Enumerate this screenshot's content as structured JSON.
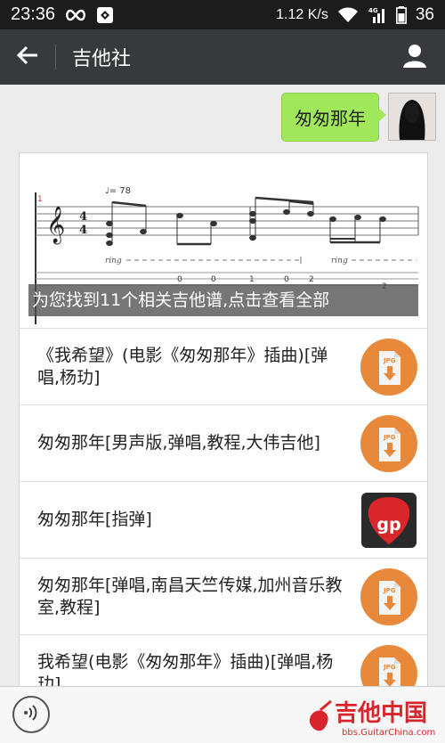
{
  "status": {
    "time": "23:36",
    "network": "4G",
    "battery_percent_text": "1.12 K/s",
    "battery_level": "36"
  },
  "header": {
    "title": "吉他社"
  },
  "message": {
    "text": "匆匆那年"
  },
  "result_card": {
    "overlay_text": "为您找到11个相关吉他谱,点击查看全部",
    "tab_preview": {
      "measure_number": "1",
      "tempo": "♩= 78",
      "time_sig_top": "4",
      "time_sig_bottom": "4",
      "ring_label": "ring",
      "tab_numbers": [
        "0",
        "0",
        "1",
        "0",
        "2",
        "2"
      ]
    },
    "items": [
      {
        "label": "《我希望》(电影《匆匆那年》插曲)[弹唱,杨玏]",
        "thumb_type": "jpg",
        "thumb_label": "JPG"
      },
      {
        "label": "匆匆那年[男声版,弹唱,教程,大伟吉他]",
        "thumb_type": "jpg",
        "thumb_label": "JPG"
      },
      {
        "label": "匆匆那年[指弹]",
        "thumb_type": "gp",
        "thumb_label": "gp"
      },
      {
        "label": "匆匆那年[弹唱,南昌天竺传媒,加州音乐教室,教程]",
        "thumb_type": "jpg",
        "thumb_label": "JPG"
      },
      {
        "label": "我希望(电影《匆匆那年》插曲)[弹唱,杨玏]",
        "thumb_type": "jpg",
        "thumb_label": "JPG"
      }
    ]
  },
  "watermark": {
    "title": "吉他中国",
    "url": "bbs.GuitarChina.com"
  },
  "colors": {
    "status_bar": "#1c1c1c",
    "app_bar": "#37393c",
    "bubble": "#a0e75a",
    "thumb_orange": "#e8883a",
    "watermark_red": "#d8252d"
  }
}
